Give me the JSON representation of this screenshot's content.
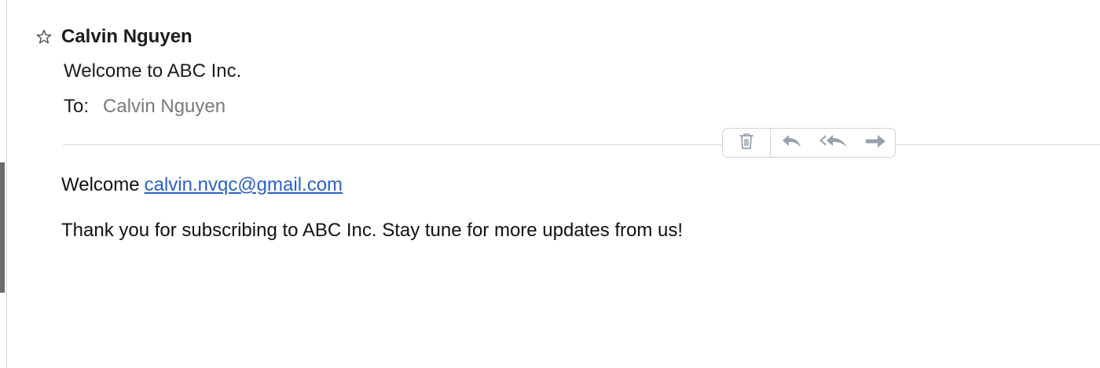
{
  "header": {
    "star_icon": "star-outline-icon",
    "sender": "Calvin Nguyen"
  },
  "subject": "Welcome to ABC Inc.",
  "recipients": {
    "label": "To:",
    "value": "Calvin Nguyen"
  },
  "toolbar": {
    "icons": [
      "trash-icon",
      "reply-icon",
      "reply-all-icon",
      "forward-icon"
    ]
  },
  "body": {
    "greeting": "Welcome",
    "email_link": "calvin.nvqc@gmail.com",
    "message": "Thank you for subscribing to ABC Inc. Stay tune for more updates from us!"
  },
  "colors": {
    "link": "#2b62c2",
    "icon": "#9aa1ad",
    "muted_text": "#7a7a7a"
  }
}
